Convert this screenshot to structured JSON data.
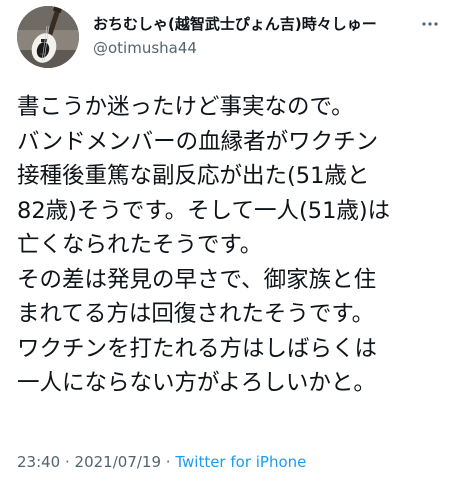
{
  "tweet": {
    "author": {
      "display_name": "おちむしゃ(越智武士ぴょん吉)時々しゅー",
      "handle": "@otimusha44",
      "avatar_icon": "bass-guitar-avatar"
    },
    "more_icon": "more-horizontal-icon",
    "lines": [
      "書こうか迷ったけど事実なので。",
      "バンドメンバーの血縁者がワクチン",
      "接種後重篤な副反応が出た(51歳と",
      "82歳)そうです。そして一人(51歳)は",
      "亡くなられたそうです。",
      "その差は発見の早さで、御家族と住",
      "まれてる方は回復されたそうです。",
      "ワクチンを打たれる方はしばらくは",
      "一人にならない方がよろしいかと。"
    ],
    "time": "23:40",
    "separator_1": " · ",
    "date": "2021/07/19",
    "separator_2": " · ",
    "source": "Twitter for iPhone"
  },
  "colors": {
    "text": "#0f1419",
    "secondary": "#536471",
    "link": "#1d9bf0"
  }
}
